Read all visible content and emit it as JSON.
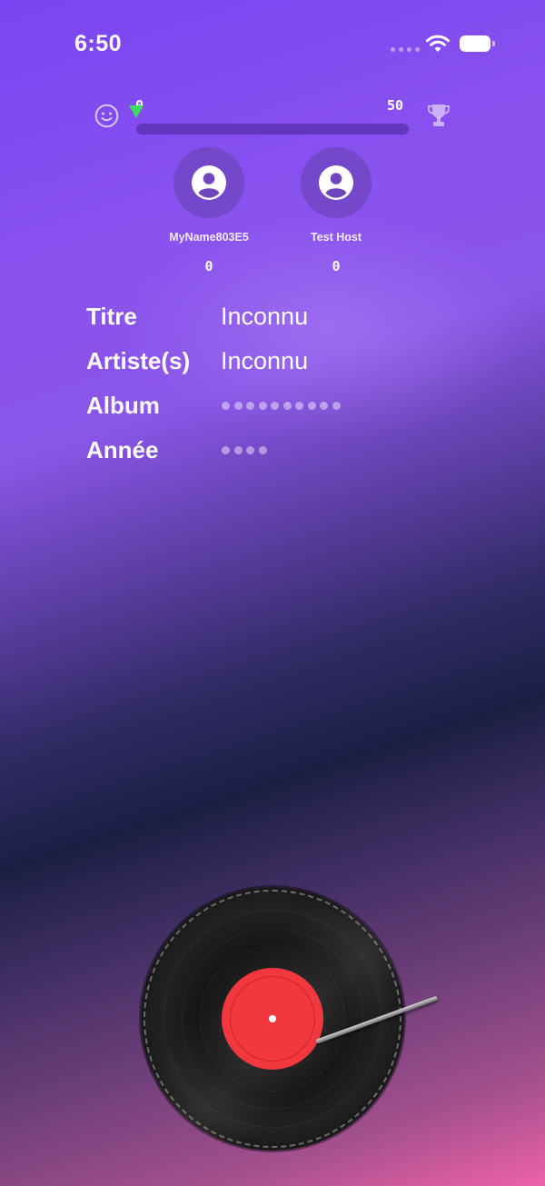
{
  "status_bar": {
    "time": "6:50",
    "wifi_icon": "wifi-icon",
    "battery_icon": "battery-icon"
  },
  "progress": {
    "min_label": "0",
    "max_label": "50",
    "value": 0,
    "left_icon": "smiley-icon",
    "right_icon": "trophy-icon",
    "marker_color": "#3ddc5f"
  },
  "players": [
    {
      "name": "MyName803E5",
      "score": "0",
      "icon": "person-icon"
    },
    {
      "name": "Test Host",
      "score": "0",
      "icon": "person-icon"
    }
  ],
  "track_info": {
    "title_label": "Titre",
    "title_value": "Inconnu",
    "artist_label": "Artiste(s)",
    "artist_value": "Inconnu",
    "album_label": "Album",
    "album_hidden_chars": 10,
    "year_label": "Année",
    "year_hidden_chars": 4
  },
  "turntable": {
    "label_color": "#f2383e",
    "icon": "vinyl-record-icon"
  }
}
